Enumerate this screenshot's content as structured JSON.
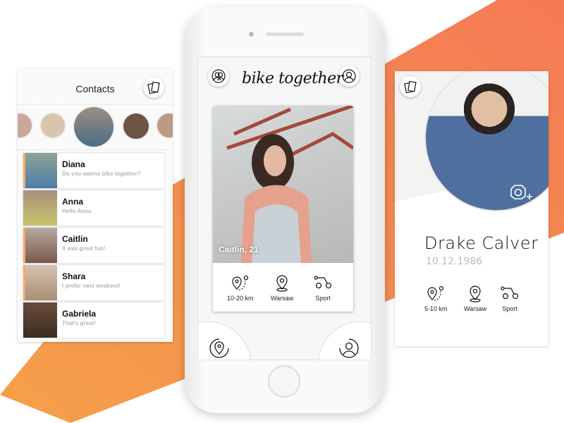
{
  "colors": {
    "accent": "#f5884f",
    "accent_light": "#fba764",
    "stripe": "#f5a04a"
  },
  "contacts": {
    "title": "Contacts",
    "cards_icon": "cards-icon",
    "items": [
      {
        "name": "Diana",
        "message": "Do you wanna bike together?",
        "unread": true
      },
      {
        "name": "Anna",
        "message": "Hello Anna",
        "unread": false
      },
      {
        "name": "Caitlin",
        "message": "It was great fun!",
        "unread": true
      },
      {
        "name": "Shara",
        "message": "I prefer next weekend",
        "unread": true
      },
      {
        "name": "Gabriela",
        "message": "That's great!",
        "unread": false
      }
    ]
  },
  "discover": {
    "app_title": "bike together",
    "left_icon": "friends-icon",
    "right_icon": "profile-icon",
    "card": {
      "caption": "Caitlin, 21",
      "distance": "10-20 km",
      "city": "Warsaw",
      "type": "Sport"
    },
    "bottom_left_icon": "location-icon",
    "bottom_right_icon": "user-icon"
  },
  "profile": {
    "name": "Drake Calver",
    "birthdate": "10.12.1986",
    "distance": "5-10 km",
    "city": "Warsaw",
    "type": "Sport",
    "camera_icon": "add-photo-icon"
  }
}
